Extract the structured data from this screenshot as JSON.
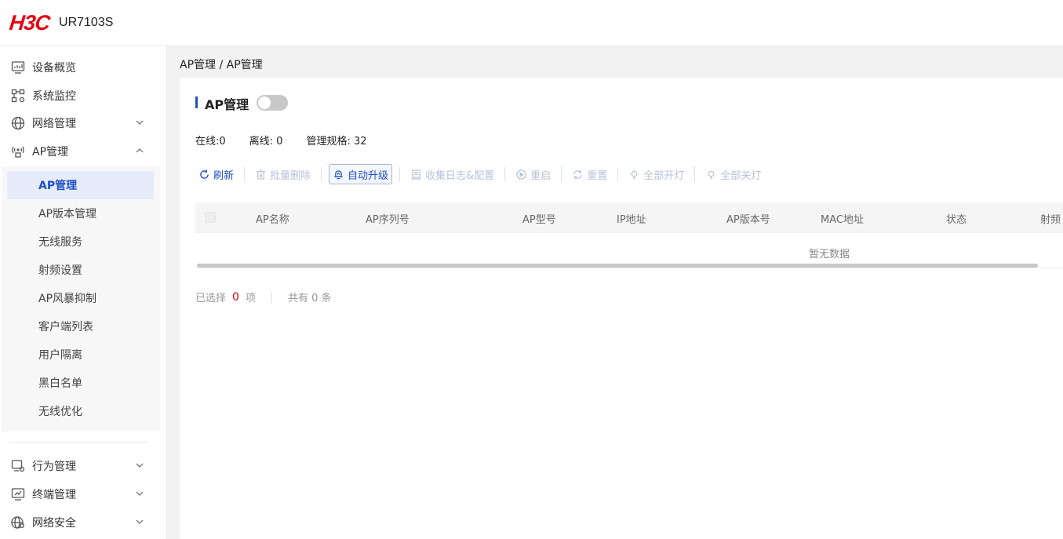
{
  "header": {
    "brand": "H3C",
    "model": "UR7103S"
  },
  "sidebar": {
    "items": [
      {
        "label": "设备概览",
        "icon": "monitor-chart-icon",
        "expandable": false
      },
      {
        "label": "系统监控",
        "icon": "network-topology-icon",
        "expandable": false
      },
      {
        "label": "网络管理",
        "icon": "globe-icon",
        "expandable": true,
        "expanded": false
      },
      {
        "label": "AP管理",
        "icon": "wireless-ap-icon",
        "expandable": true,
        "expanded": true
      },
      {
        "label": "行为管理",
        "icon": "behavior-monitor-icon",
        "expandable": true,
        "expanded": false
      },
      {
        "label": "终端管理",
        "icon": "terminal-monitor-icon",
        "expandable": true,
        "expanded": false
      },
      {
        "label": "网络安全",
        "icon": "globe-shield-icon",
        "expandable": true,
        "expanded": false
      }
    ],
    "sub_items": [
      {
        "label": "AP管理",
        "active": true
      },
      {
        "label": "AP版本管理",
        "active": false
      },
      {
        "label": "无线服务",
        "active": false
      },
      {
        "label": "射频设置",
        "active": false
      },
      {
        "label": "AP风暴抑制",
        "active": false
      },
      {
        "label": "客户端列表",
        "active": false
      },
      {
        "label": "用户隔离",
        "active": false
      },
      {
        "label": "黑白名单",
        "active": false
      },
      {
        "label": "无线优化",
        "active": false
      }
    ]
  },
  "breadcrumb": "AP管理 / AP管理",
  "page": {
    "title": "AP管理",
    "toggle_on": false,
    "stats": {
      "online": "在线:0",
      "offline": "离线: 0",
      "capacity": "管理规格: 32"
    }
  },
  "toolbar": {
    "refresh": "刷新",
    "batch_delete": "批量删除",
    "auto_upgrade": "自动升级",
    "collect_logs": "收集日志&配置",
    "reboot": "重启",
    "reset": "重置",
    "all_lights_on": "全部开灯",
    "all_lights_off": "全部关灯"
  },
  "table": {
    "columns": [
      "AP名称",
      "AP序列号",
      "AP型号",
      "IP地址",
      "AP版本号",
      "MAC地址",
      "状态",
      "射频"
    ],
    "rows": [],
    "empty_text": "暂无数据"
  },
  "footer": {
    "selected_prefix": "已选择",
    "selected_count": "0",
    "selected_suffix": "项",
    "total": "共有 0 条"
  },
  "colors": {
    "brand": "#e60012",
    "accent": "#1f4fc4",
    "active_bg": "#e6ecfa"
  }
}
